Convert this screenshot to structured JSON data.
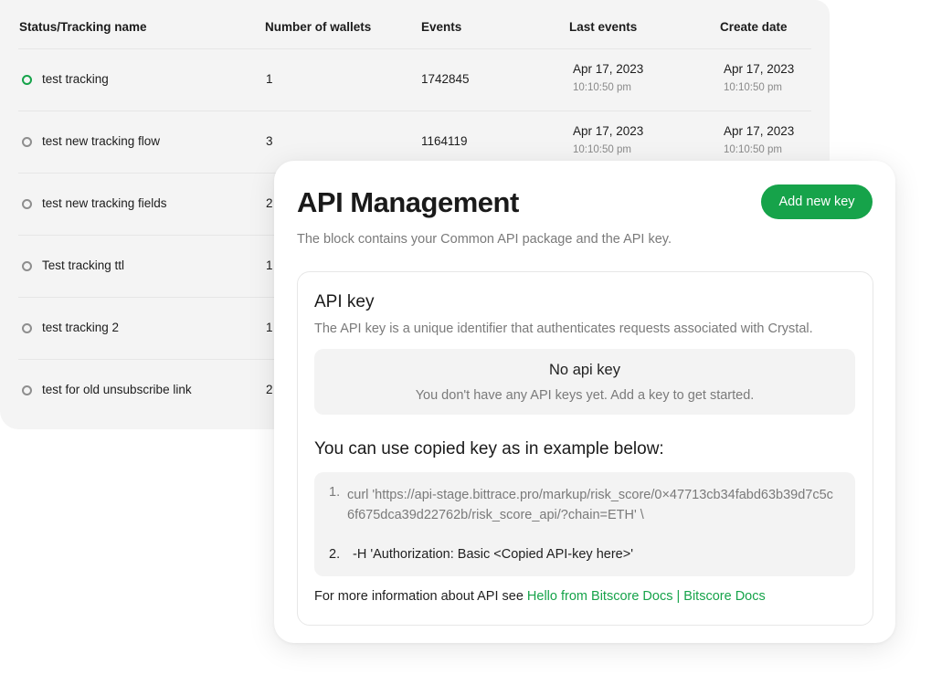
{
  "table": {
    "headers": {
      "name": "Status/Tracking name",
      "wallets": "Number of wallets",
      "events": "Events",
      "last_events": "Last events",
      "create_date": "Create date"
    },
    "rows": [
      {
        "status": "active",
        "name": "test tracking",
        "wallets": "1",
        "events": "1742845",
        "last_date": "Apr 17, 2023",
        "last_time": "10:10:50 pm",
        "create_date": "Apr 17, 2023",
        "create_time": "10:10:50 pm"
      },
      {
        "status": "inactive",
        "name": "test new tracking flow",
        "wallets": "3",
        "events": "1164119",
        "last_date": "Apr 17, 2023",
        "last_time": "10:10:50 pm",
        "create_date": "Apr 17, 2023",
        "create_time": "10:10:50 pm"
      },
      {
        "status": "inactive",
        "name": "test new tracking fields",
        "wallets": "2",
        "events": "",
        "last_date": "",
        "last_time": "",
        "create_date": "",
        "create_time": ""
      },
      {
        "status": "inactive",
        "name": "Test tracking ttl",
        "wallets": "1",
        "events": "",
        "last_date": "",
        "last_time": "",
        "create_date": "",
        "create_time": ""
      },
      {
        "status": "inactive",
        "name": "test tracking 2",
        "wallets": "1",
        "events": "",
        "last_date": "",
        "last_time": "",
        "create_date": "",
        "create_time": ""
      },
      {
        "status": "inactive",
        "name": "test for old unsubscribe link",
        "wallets": "2",
        "events": "",
        "last_date": "",
        "last_time": "",
        "create_date": "",
        "create_time": ""
      }
    ]
  },
  "api_card": {
    "title": "API Management",
    "subtitle": "The block contains your Common API package and the API key.",
    "add_button": "Add new key",
    "api_key": {
      "title": "API key",
      "description": "The API key is a unique identifier that authenticates requests associated with Crystal.",
      "empty_title": "No api key",
      "empty_subtitle": "You don't have any API keys yet. Add a key to get started."
    },
    "example": {
      "title": "You can use copied key as in example below:",
      "lines": [
        {
          "num": "1.",
          "text": "curl 'https://api-stage.bittrace.pro/markup/risk_score/0×47713cb34fabd63b39d7c5c6f675dca39d22762b/risk_score_api/?chain=ETH' \\"
        },
        {
          "num": "2.",
          "text": "-H 'Authorization: Basic <Copied API-key here>'"
        }
      ]
    },
    "more_info": {
      "text": "For more information about API see ",
      "link": "Hello from Bitscore Docs | Bitscore Docs"
    }
  },
  "colors": {
    "accent": "#16a34a",
    "panel_bg": "#f4f4f4",
    "muted_text": "#7a7a7a"
  }
}
